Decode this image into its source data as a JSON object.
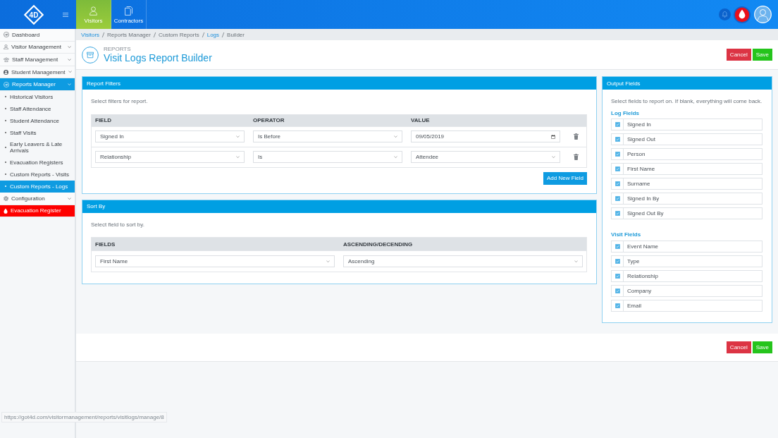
{
  "topbar": {
    "logo": "4D",
    "tabs": [
      {
        "label": "Visitors",
        "selected": true
      },
      {
        "label": "Contractors",
        "selected": false
      }
    ]
  },
  "sidebar": {
    "items": [
      {
        "label": "Dashboard",
        "kind": "link",
        "selected": false
      },
      {
        "label": "Visitor Management",
        "kind": "group",
        "selected": false
      },
      {
        "label": "Staff Management",
        "kind": "group",
        "selected": false
      },
      {
        "label": "Student Management",
        "kind": "group",
        "selected": false
      },
      {
        "label": "Reports Manager",
        "kind": "group",
        "selected": true,
        "children": [
          {
            "label": "Historical Visitors",
            "selected": false
          },
          {
            "label": "Staff Attendance",
            "selected": false
          },
          {
            "label": "Student Attendance",
            "selected": false
          },
          {
            "label": "Staff Visits",
            "selected": false
          },
          {
            "label": "Early Leavers & Late Arrivals",
            "selected": false
          },
          {
            "label": "Evacuation Registers",
            "selected": false
          },
          {
            "label": "Custom Reports - Visits",
            "selected": false
          },
          {
            "label": "Custom Reports - Logs",
            "selected": true
          }
        ]
      },
      {
        "label": "Configuration",
        "kind": "group",
        "selected": false
      },
      {
        "label": "Evacuation Register",
        "kind": "alert",
        "selected": false
      }
    ]
  },
  "breadcrumb": [
    {
      "label": "Visitors",
      "link": true
    },
    {
      "label": "Reports Manager",
      "link": false
    },
    {
      "label": "Custom Reports",
      "link": false
    },
    {
      "label": "Logs",
      "link": true
    },
    {
      "label": "Builder",
      "link": false
    }
  ],
  "header": {
    "eyebrow": "REPORTS",
    "title": "Visit Logs Report Builder",
    "buttons": [
      {
        "label": "Cancel",
        "kind": "cancel"
      },
      {
        "label": "Save",
        "kind": "save"
      }
    ]
  },
  "report_filters": {
    "title": "Report Filters",
    "hint": "Select filters for report.",
    "columns": [
      "FIELD",
      "OPERATOR",
      "VALUE"
    ],
    "rows": [
      {
        "field": "Signed In",
        "operator": "Is Before",
        "value": {
          "kind": "date",
          "text": "09/05/2019"
        }
      },
      {
        "field": "Relationship",
        "operator": "Is",
        "value": {
          "kind": "select",
          "text": "Attendee"
        }
      }
    ],
    "add_button": "Add New Field"
  },
  "sort_by": {
    "title": "Sort By",
    "hint": "Select field to sort by.",
    "columns": [
      "FIELDS",
      "ASCENDING/DECENDING"
    ],
    "rows": [
      {
        "field": "First Name",
        "order": "Ascending"
      }
    ]
  },
  "output_fields": {
    "title": "Output Fields",
    "hint": "Select fields to report on. If blank, everything will come back.",
    "groups": [
      {
        "heading": "Log Fields",
        "fields": [
          {
            "label": "Signed In",
            "checked": true
          },
          {
            "label": "Signed Out",
            "checked": true
          },
          {
            "label": "Person",
            "checked": true
          },
          {
            "label": "First Name",
            "checked": true
          },
          {
            "label": "Surname",
            "checked": true
          },
          {
            "label": "Signed In By",
            "checked": true
          },
          {
            "label": "Signed Out By",
            "checked": true
          }
        ]
      },
      {
        "heading": "Visit Fields",
        "fields": [
          {
            "label": "Event Name",
            "checked": true
          },
          {
            "label": "Type",
            "checked": true
          },
          {
            "label": "Relationship",
            "checked": true
          },
          {
            "label": "Company",
            "checked": true
          },
          {
            "label": "Email",
            "checked": true
          }
        ]
      }
    ]
  },
  "footer": {
    "buttons": [
      {
        "label": "Cancel",
        "kind": "cancel"
      },
      {
        "label": "Save",
        "kind": "save"
      }
    ]
  },
  "status_url": "https://got4d.com/visitormanagement/reports/visitlogs/manage/8"
}
